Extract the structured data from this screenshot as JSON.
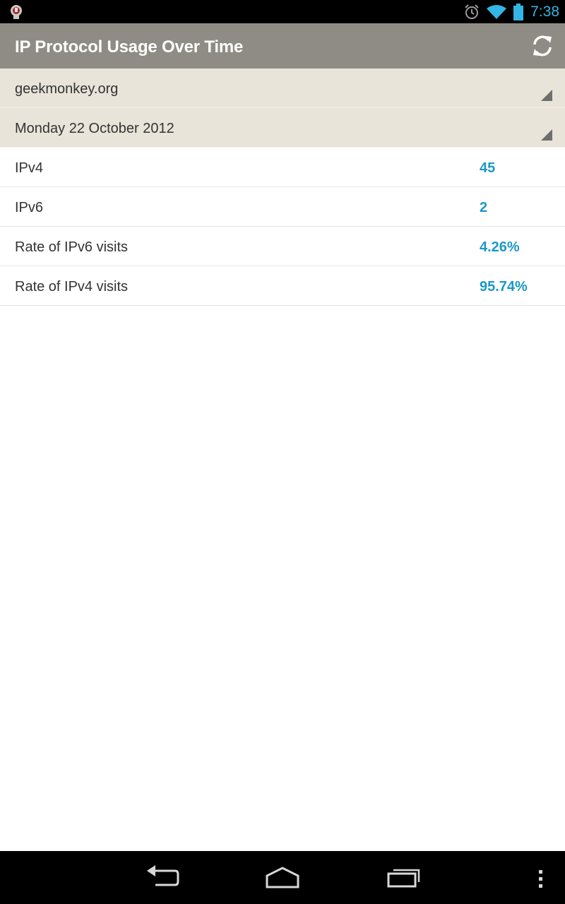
{
  "status_bar": {
    "time": "7:38",
    "time_color": "#33b5e5",
    "icons": [
      "app-notification-icon",
      "alarm-icon",
      "wifi-icon",
      "battery-icon"
    ]
  },
  "action_bar": {
    "title": "IP Protocol Usage Over Time",
    "background_color": "#8e8c84",
    "refresh_icon": "refresh-icon"
  },
  "spinners": {
    "site": {
      "selected": "geekmonkey.org"
    },
    "date": {
      "selected": "Monday 22 October 2012"
    }
  },
  "stats": [
    {
      "label": "IPv4",
      "value": "45"
    },
    {
      "label": "IPv6",
      "value": "2"
    },
    {
      "label": "Rate of IPv6 visits",
      "value": "4.26%"
    },
    {
      "label": "Rate of IPv4 visits",
      "value": "95.74%"
    }
  ],
  "value_color": "#1b98c8",
  "nav_bar": {
    "buttons": [
      "back-icon",
      "home-icon",
      "recent-apps-icon",
      "overflow-menu-icon"
    ]
  }
}
